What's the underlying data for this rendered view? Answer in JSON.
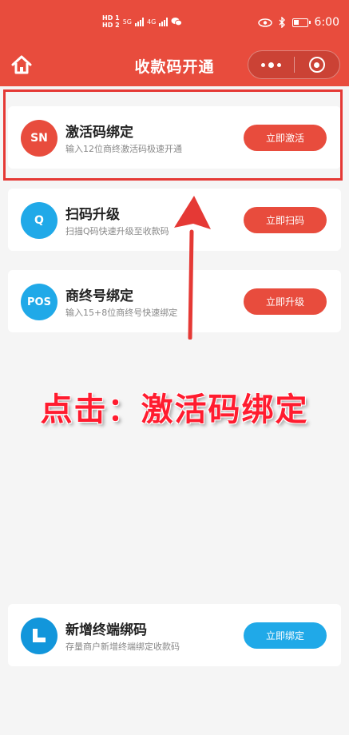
{
  "status_bar": {
    "hd1": "HD 1",
    "hd2": "HD 2",
    "net1": "5G",
    "net2": "4G",
    "time": "6:00"
  },
  "nav": {
    "title": "收款码开通",
    "icons": {
      "home": "home-icon",
      "more": "more-dots-icon",
      "close": "target-close-icon"
    }
  },
  "cards": [
    {
      "icon_text": "SN",
      "title": "激活码绑定",
      "desc": "输入12位商终激活码极速开通",
      "button": "立即激活",
      "color": "#e84c3d"
    },
    {
      "icon_text": "Q",
      "title": "扫码升级",
      "desc": "扫描Q码快速升级至收款码",
      "button": "立即扫码",
      "color": "#20a9e8"
    },
    {
      "icon_text": "POS",
      "title": "商终号绑定",
      "desc": "输入15+8位商终号快速绑定",
      "button": "立即升级",
      "color": "#20a9e8"
    },
    {
      "icon_text": "",
      "title": "新增终端绑码",
      "desc": "存量商户新增终端绑定收款码",
      "button": "立即绑定",
      "color": "#1296db"
    }
  ],
  "annotation": "点击：激活码绑定",
  "colors": {
    "primary_red": "#e84c3d",
    "blue": "#20a9e8",
    "annotation_red": "#ff1c2f"
  }
}
